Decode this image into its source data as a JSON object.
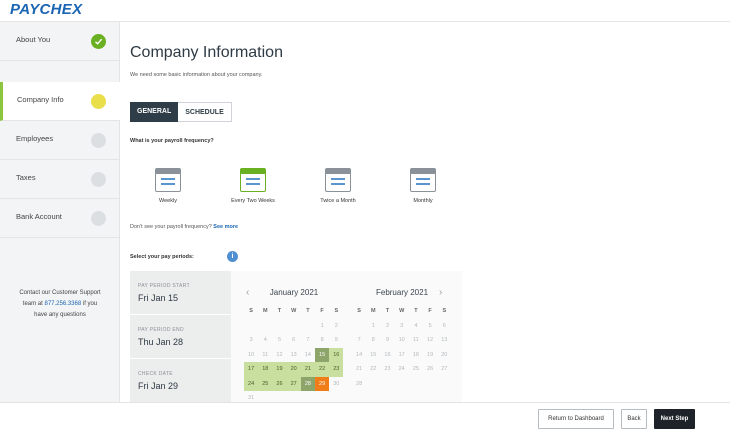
{
  "brand": {
    "logo_text": "PAYCHEX",
    "color": "#1a66b3"
  },
  "sidebar": {
    "steps": [
      {
        "label": "About You",
        "status": "complete"
      },
      {
        "label": "Company Info",
        "status": "current"
      },
      {
        "label": "Employees",
        "status": "pending"
      },
      {
        "label": "Taxes",
        "status": "pending"
      },
      {
        "label": "Bank Account",
        "status": "pending"
      }
    ],
    "support": {
      "line1": "Contact our Customer Support",
      "team_prefix": "team at ",
      "phone": "877.256.3368",
      "suffix": " if you",
      "line3": "have any questions"
    }
  },
  "main": {
    "title": "Company Information",
    "subtitle": "We need some basic information about your company.",
    "tabs": [
      {
        "label": "GENERAL",
        "selected": true
      },
      {
        "label": "SCHEDULE",
        "selected": false
      }
    ],
    "question": "What is your payroll frequency?",
    "frequencies": [
      {
        "label": "Weekly",
        "selected": false
      },
      {
        "label": "Every Two Weeks",
        "selected": true
      },
      {
        "label": "Twice a Month",
        "selected": false
      },
      {
        "label": "Monthly",
        "selected": false
      }
    ],
    "dont_see": "Don't see your payroll frequency?",
    "see_more": "See more",
    "periods_label": "Select your pay periods:",
    "info_icon": "i"
  },
  "pay_dates": [
    {
      "label": "PAY PERIOD START",
      "value": "Fri Jan 15"
    },
    {
      "label": "PAY PERIOD END",
      "value": "Thu Jan 28"
    },
    {
      "label": "CHECK DATE",
      "value": "Fri Jan 29"
    }
  ],
  "calendars": [
    {
      "title": "January 2021",
      "weekdays": [
        "S",
        "M",
        "T",
        "W",
        "T",
        "F",
        "S"
      ],
      "weeks": [
        [
          "",
          "",
          "",
          "",
          "",
          "1",
          "2"
        ],
        [
          "3",
          "4",
          "5",
          "6",
          "7",
          "8",
          "9"
        ],
        [
          "10",
          "11",
          "12",
          "13",
          "14",
          "15",
          "16"
        ],
        [
          "17",
          "18",
          "19",
          "20",
          "21",
          "22",
          "23"
        ],
        [
          "24",
          "25",
          "26",
          "27",
          "28",
          "29",
          "30"
        ],
        [
          "31",
          "",
          "",
          "",
          "",
          "",
          ""
        ]
      ]
    },
    {
      "title": "February 2021",
      "weekdays": [
        "S",
        "M",
        "T",
        "W",
        "T",
        "F",
        "S"
      ],
      "weeks": [
        [
          "",
          "1",
          "2",
          "3",
          "4",
          "5",
          "6"
        ],
        [
          "7",
          "8",
          "9",
          "10",
          "11",
          "12",
          "13"
        ],
        [
          "14",
          "15",
          "16",
          "17",
          "18",
          "19",
          "20"
        ],
        [
          "21",
          "22",
          "23",
          "24",
          "25",
          "26",
          "27"
        ],
        [
          "28",
          "",
          "",
          "",
          "",
          "",
          ""
        ]
      ]
    }
  ],
  "icons": {
    "prev": "‹",
    "next": "›"
  },
  "footer": {
    "return_label": "Return to Dashboard",
    "back_label": "Back",
    "next_label": "Next Step"
  },
  "colors": {
    "accent_green": "#6ab023",
    "current_yellow": "#e9df4a",
    "period_range": "#c8dfa0",
    "check_date": "#f07d18",
    "dark_button": "#1d2328"
  }
}
